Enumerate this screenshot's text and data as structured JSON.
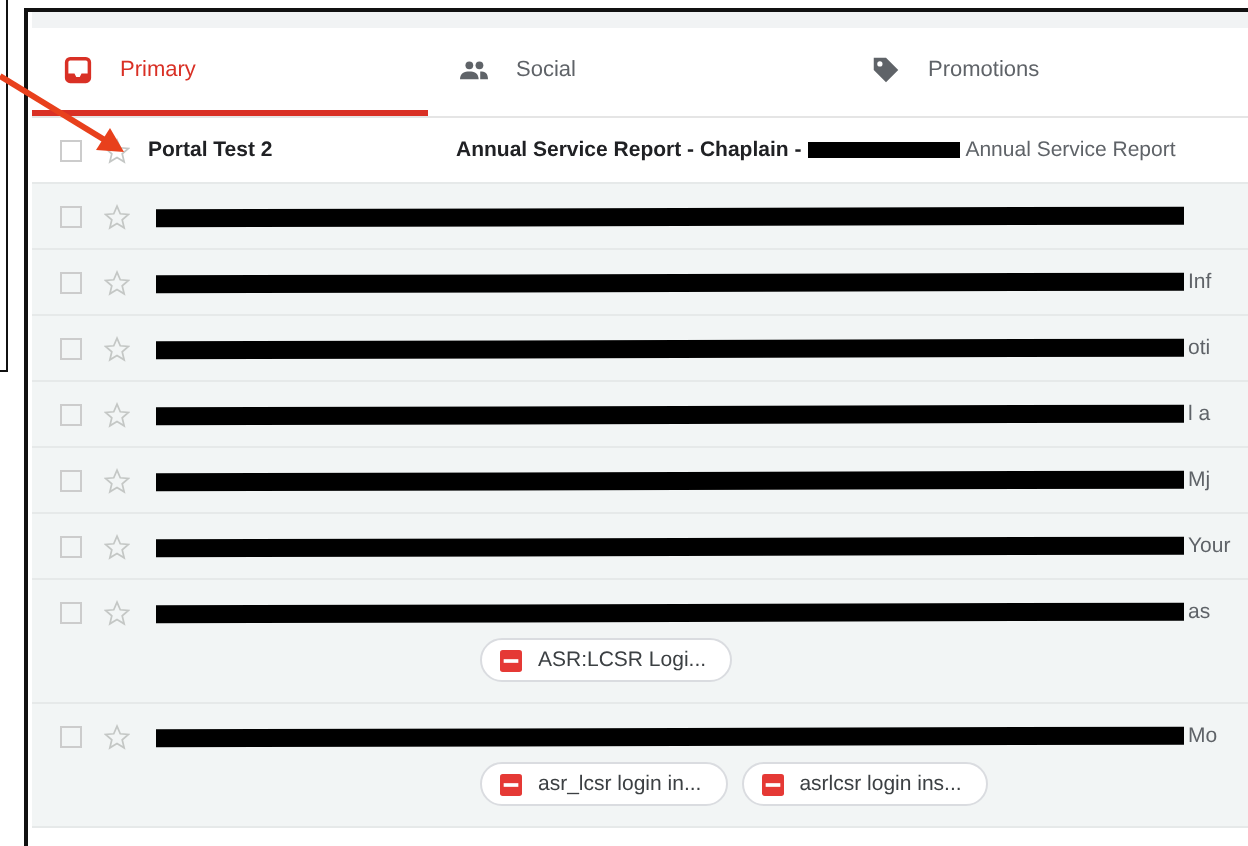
{
  "tabs": [
    {
      "label": "Primary",
      "kind": "inbox",
      "selected": true
    },
    {
      "label": "Social",
      "kind": "people",
      "selected": false
    },
    {
      "label": "Promotions",
      "kind": "tag",
      "selected": false
    }
  ],
  "emails": [
    {
      "checked": false,
      "starred": false,
      "unread": true,
      "redacted": false,
      "sender": "Portal Test 2",
      "subject": "Annual Service Report - Chaplain -",
      "name_redacted": true,
      "snippet": "Annual Service Report"
    },
    {
      "checked": false,
      "starred": false,
      "unread": false,
      "redacted": true
    },
    {
      "checked": false,
      "starred": false,
      "unread": false,
      "redacted": true,
      "snippet": "Inf"
    },
    {
      "checked": false,
      "starred": false,
      "unread": false,
      "redacted": true,
      "snippet": "oti"
    },
    {
      "checked": false,
      "starred": false,
      "unread": false,
      "redacted": true,
      "snippet": "l a"
    },
    {
      "checked": false,
      "starred": false,
      "unread": false,
      "redacted": true,
      "snippet": "Mj"
    },
    {
      "checked": false,
      "starred": false,
      "unread": false,
      "redacted": true,
      "snippet": "Your"
    },
    {
      "checked": false,
      "starred": false,
      "unread": false,
      "redacted": true,
      "snippet": "as",
      "attachments": [
        "ASR:LCSR Logi..."
      ]
    },
    {
      "checked": false,
      "starred": false,
      "unread": false,
      "redacted": true,
      "snippet": "Mo",
      "attachments": [
        "asr_lcsr login in...",
        "asrlcsr login ins..."
      ]
    }
  ]
}
